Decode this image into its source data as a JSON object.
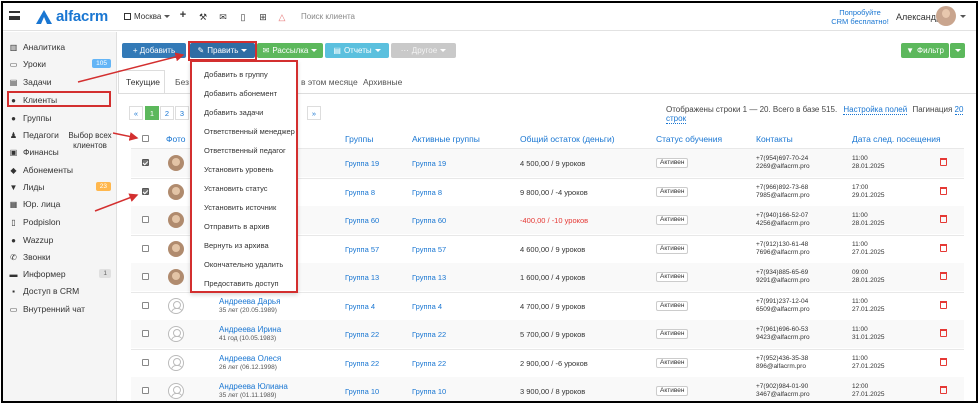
{
  "topbar": {
    "logo": "alfacrm",
    "city": "Москва",
    "search_placeholder": "Поиск клиента",
    "promo": [
      "Попробуйте",
      "CRM бесплатно!"
    ],
    "username": "Александра",
    "icons": [
      "plus-icon",
      "wrench-icon",
      "mail-icon",
      "phone-icon",
      "cart-icon",
      "bell-icon"
    ]
  },
  "sidebar": {
    "items": [
      {
        "label": "Аналитика",
        "icon": "chart-icon"
      },
      {
        "label": "Уроки",
        "icon": "calendar-icon",
        "badge": "105"
      },
      {
        "label": "Задачи",
        "icon": "tasks-icon"
      },
      {
        "label": "Клиенты",
        "icon": "user-icon"
      },
      {
        "label": "Группы",
        "icon": "users-icon"
      },
      {
        "label": "Педагоги",
        "icon": "teacher-icon"
      },
      {
        "label": "Финансы",
        "icon": "wallet-icon"
      },
      {
        "label": "Абонементы",
        "icon": "tag-icon"
      },
      {
        "label": "Лиды",
        "icon": "funnel-icon",
        "badge": "23"
      },
      {
        "label": "Юр. лица",
        "icon": "building-icon"
      },
      {
        "label": "Podpislon",
        "icon": "doc-icon"
      },
      {
        "label": "Wazzup",
        "icon": "chat-icon"
      },
      {
        "label": "Звонки",
        "icon": "phone-icon"
      },
      {
        "label": "Информер",
        "icon": "comment-icon",
        "badge": "1"
      },
      {
        "label": "Доступ в CRM",
        "icon": "lock-icon"
      },
      {
        "label": "Внутренний чат",
        "icon": "chat-bubbles-icon"
      }
    ]
  },
  "toolbar": {
    "add": "+ Добавить",
    "edit": "Править",
    "mailing": "Рассылка",
    "reports": "Отчеты",
    "other": "Другое",
    "filter": "Фильтр"
  },
  "tabs": [
    "Текущие",
    "Без",
    "в этом месяце",
    "Архивные"
  ],
  "annotation": "Выбор всех клиентов",
  "pagination": {
    "prev": "«",
    "pages": [
      "1",
      "2",
      "3"
    ],
    "next": "»",
    "shown": "Отображены строки 1 — 20. Всего в базе 515.",
    "settings_link": "Настройка полей",
    "per_page_label": "Пагинация",
    "per_page_link": "20 строк"
  },
  "table": {
    "headers": {
      "photo": "Фото",
      "groups": "Группы",
      "active_groups": "Активные группы",
      "balance": "Общий остаток (деньги)",
      "status": "Статус обучения",
      "contacts": "Контакты",
      "next_date": "Дата след. посещения"
    },
    "rows": [
      {
        "checked": true,
        "photo": true,
        "name": "",
        "age": "",
        "group": "Группа 19",
        "agroup": "Группа 19",
        "balance": "4 500,00 / 9 уроков",
        "neg": false,
        "status": "Активен",
        "phone": "+7(954)697-70-24",
        "email": "2269@alfacrm.pro",
        "time": "11:00",
        "date": "28.01.2025"
      },
      {
        "checked": true,
        "photo": true,
        "name": "",
        "age": "",
        "group": "Группа 8",
        "agroup": "Группа 8",
        "balance": "9 800,00 / -4 уроков",
        "neg": false,
        "status": "Активен",
        "phone": "+7(966)892-73-68",
        "email": "7985@alfacrm.pro",
        "time": "17:00",
        "date": "29.01.2025"
      },
      {
        "checked": false,
        "photo": true,
        "name": "",
        "age": "",
        "group": "Группа 60",
        "agroup": "Группа 60",
        "balance": "-400,00 / -10 уроков",
        "neg": true,
        "status": "Активен",
        "phone": "+7(940)166-52-07",
        "email": "4256@alfacrm.pro",
        "time": "11:00",
        "date": "28.01.2025"
      },
      {
        "checked": false,
        "photo": true,
        "name": "",
        "age": "",
        "group": "Группа 57",
        "agroup": "Группа 57",
        "balance": "4 600,00 / 9 уроков",
        "neg": false,
        "status": "Активен",
        "phone": "+7(912)130-61-48",
        "email": "7696@alfacrm.pro",
        "time": "11:00",
        "date": "27.01.2025"
      },
      {
        "checked": false,
        "photo": true,
        "name": "",
        "age": "",
        "group": "Группа 13",
        "agroup": "Группа 13",
        "balance": "1 600,00 / 4 уроков",
        "neg": false,
        "status": "Активен",
        "phone": "+7(934)885-65-69",
        "email": "9291@alfacrm.pro",
        "time": "09:00",
        "date": "28.01.2025"
      },
      {
        "checked": false,
        "photo": false,
        "name": "Андреева Дарья",
        "age": "35 лет (20.05.1989)",
        "group": "Группа 4",
        "agroup": "Группа 4",
        "balance": "4 700,00 / 9 уроков",
        "neg": false,
        "status": "Активен",
        "phone": "+7(991)237-12-04",
        "email": "6509@alfacrm.pro",
        "time": "11:00",
        "date": "27.01.2025"
      },
      {
        "checked": false,
        "photo": false,
        "name": "Андреева Ирина",
        "age": "41 год (10.05.1983)",
        "group": "Группа 22",
        "agroup": "Группа 22",
        "balance": "5 700,00 / 9 уроков",
        "neg": false,
        "status": "Активен",
        "phone": "+7(961)696-60-53",
        "email": "9423@alfacrm.pro",
        "time": "11:00",
        "date": "31.01.2025"
      },
      {
        "checked": false,
        "photo": false,
        "name": "Андреева Олеся",
        "age": "26 лет (06.12.1998)",
        "group": "Группа 22",
        "agroup": "Группа 22",
        "balance": "2 900,00 / -6 уроков",
        "neg": false,
        "status": "Активен",
        "phone": "+7(952)436-35-38",
        "email": "896@alfacrm.pro",
        "time": "11:00",
        "date": "27.01.2025"
      },
      {
        "checked": false,
        "photo": false,
        "name": "Андреева Юлиана",
        "age": "35 лет (01.11.1989)",
        "group": "Группа 10",
        "agroup": "Группа 10",
        "balance": "3 900,00 / 8 уроков",
        "neg": false,
        "status": "Активен",
        "phone": "+7(902)984-01-90",
        "email": "3467@alfacrm.pro",
        "time": "12:00",
        "date": "27.01.2025"
      }
    ]
  },
  "dropdown": {
    "items": [
      "Добавить в группу",
      "Добавить абонемент",
      "Добавить задачи",
      "Ответственный менеджер",
      "Ответственный педагог",
      "Установить уровень",
      "Установить статус",
      "Установить источник",
      "Отправить в архив",
      "Вернуть из архива",
      "Окончательно удалить",
      "Предоставить доступ"
    ]
  },
  "colors": {
    "brand": "#1976d2",
    "highlight_red": "#d32f2f",
    "btn_blue": "#337ab7",
    "btn_green": "#5cb85c",
    "btn_cyan": "#5bc0de",
    "negative": "#e53935"
  }
}
